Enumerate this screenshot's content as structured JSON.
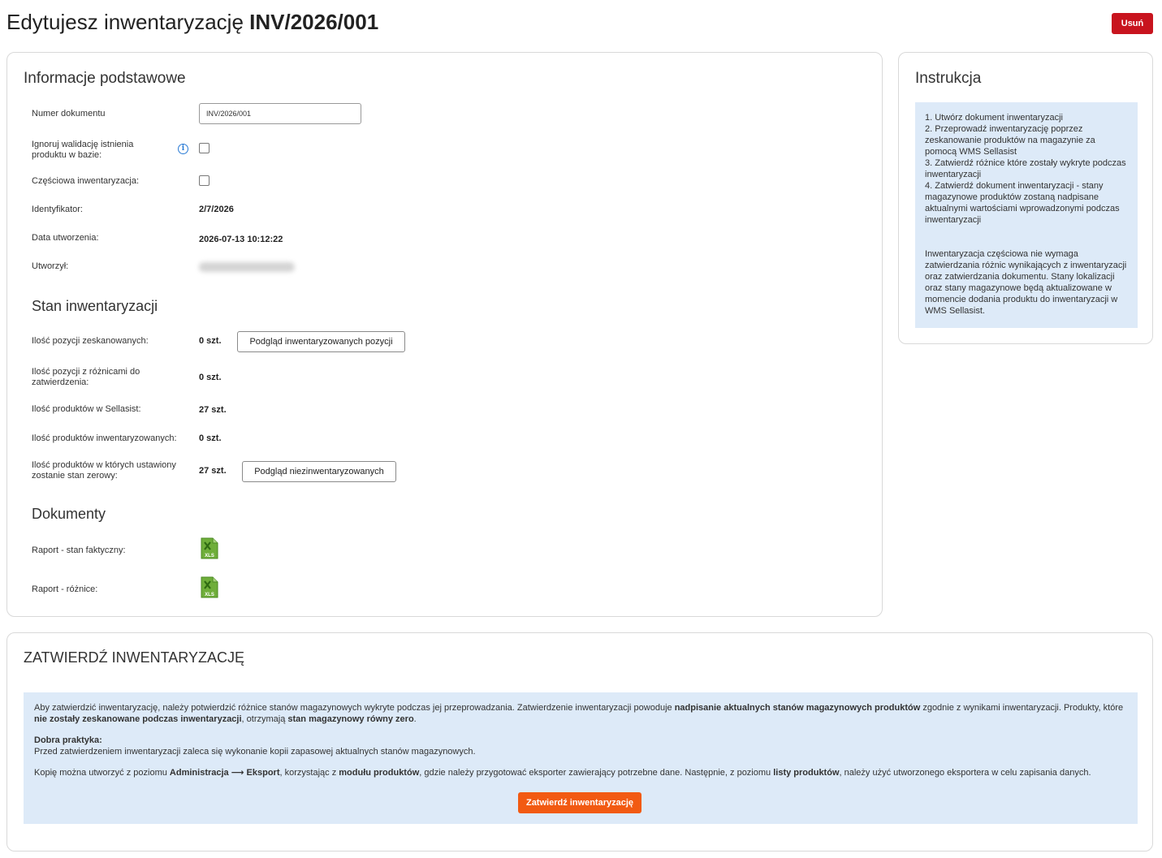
{
  "header": {
    "title_prefix": "Edytujesz inwentaryzację",
    "doc_number": "INV/2026/001",
    "delete_label": "Usuń"
  },
  "basic": {
    "title": "Informacje podstawowe",
    "doc_number_label": "Numer dokumentu",
    "doc_number_value": "INV/2026/001",
    "ignore_validation_label": "Ignoruj walidację istnienia produktu w bazie:",
    "ignore_validation_checked": false,
    "partial_label": "Częściowa inwentaryzacja:",
    "partial_checked": false,
    "identifier_label": "Identyfikator:",
    "identifier_value": "2/7/2026",
    "created_label": "Data utworzenia:",
    "created_value": "2026-07-13 10:12:22",
    "author_label": "Utworzył:"
  },
  "status": {
    "title": "Stan inwentaryzacji",
    "scanned_label": "Ilość pozycji zeskanowanych:",
    "scanned_value": "0 szt.",
    "scanned_button": "Podgląd inwentaryzowanych pozycji",
    "diff_label": "Ilość pozycji z różnicami do zatwierdzenia:",
    "diff_value": "0 szt.",
    "sellasist_label": "Ilość produktów w Sellasist:",
    "sellasist_value": "27 szt.",
    "inventoried_label": "Ilość produktów inwentaryzowanych:",
    "inventoried_value": "0 szt.",
    "zero_label": "Ilość produktów w których ustawiony zostanie stan zerowy:",
    "zero_value": "27 szt.",
    "zero_button": "Podgląd niezinwentaryzowanych"
  },
  "documents": {
    "title": "Dokumenty",
    "report_actual_label": "Raport - stan faktyczny:",
    "report_diff_label": "Raport - różnice:",
    "file_icon_text": "XLS"
  },
  "instructions": {
    "title": "Instrukcja",
    "steps": [
      "1. Utwórz dokument inwentaryzacji",
      "2. Przeprowadź inwentaryzację poprzez zeskanowanie produktów na magazynie za pomocą WMS Sellasist",
      "3. Zatwierdź różnice które zostały wykryte podczas inwentaryzacji",
      "4. Zatwierdź dokument inwentaryzacji - stany magazynowe produktów zostaną nadpisane aktualnymi wartościami wprowadzonymi podczas inwentaryzacji"
    ],
    "partial_note": "Inwentaryzacja częściowa nie wymaga zatwierdzania różnic wynikających z inwentaryzacji oraz zatwierdzania dokumentu. Stany lokalizacji oraz stany magazynowe będą aktualizowane w momencie dodania produktu do inwentaryzacji w WMS Sellasist."
  },
  "confirm": {
    "title": "ZATWIERDŹ INWENTARYZACJĘ",
    "p1_a": "Aby zatwierdzić inwentaryzację, należy potwierdzić różnice stanów magazynowych wykryte podczas jej przeprowadzania. Zatwierdzenie inwentaryzacji powoduje ",
    "p1_b": "nadpisanie aktualnych stanów magazynowych produktów",
    "p1_c": " zgodnie z wynikami inwentaryzacji. Produkty, które ",
    "p1_d": "nie zostały zeskanowane podczas inwentaryzacji",
    "p1_e": ", otrzymają ",
    "p1_f": "stan magazynowy równy zero",
    "p1_g": ".",
    "good_practice_label": "Dobra praktyka:",
    "good_practice_text": "Przed zatwierdzeniem inwentaryzacji zaleca się wykonanie kopii zapasowej aktualnych stanów magazynowych.",
    "p3_a": "Kopię można utworzyć z poziomu ",
    "p3_b": "Administracja ⟶ Eksport",
    "p3_c": ", korzystając z ",
    "p3_d": "modułu produktów",
    "p3_e": ", gdzie należy przygotować eksporter zawierający potrzebne dane. Następnie, z poziomu ",
    "p3_f": "listy produktów",
    "p3_g": ", należy użyć utworzonego eksportera w celu zapisania danych.",
    "button": "Zatwierdź inwentaryzację"
  },
  "colors": {
    "delete": "#c8141e",
    "confirm": "#f25a12",
    "info_bg": "#ddeaf8",
    "info_icon": "#2a7bd5",
    "xls": "#5c9e2e"
  }
}
